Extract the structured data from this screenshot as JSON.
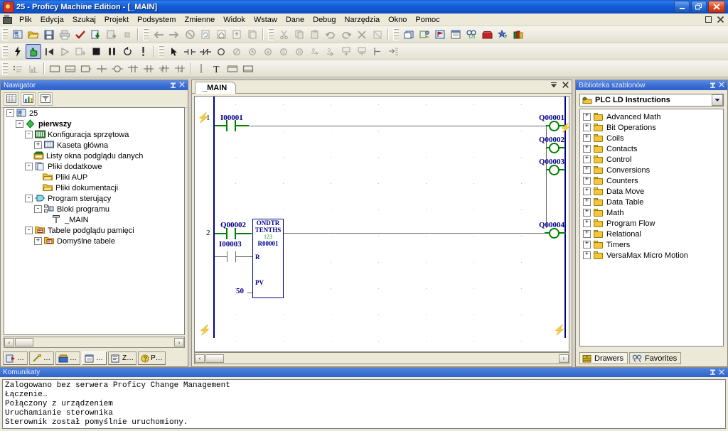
{
  "window": {
    "title": "25 - Proficy Machine Edition - [_MAIN]",
    "app_icon": "proficy-icon",
    "minimize": "–",
    "restore": "❐",
    "close": "✕"
  },
  "menubar": {
    "system_icon": "mdi-system-icon",
    "items": [
      {
        "label": "Plik",
        "accel": "P"
      },
      {
        "label": "Edycja",
        "accel": "E"
      },
      {
        "label": "Szukaj",
        "accel": "S"
      },
      {
        "label": "Projekt",
        "accel": "P"
      },
      {
        "label": "Podsystem",
        "accel": "o"
      },
      {
        "label": "Zmienne",
        "accel": "Z"
      },
      {
        "label": "Widok",
        "accel": "W"
      },
      {
        "label": "Wstaw",
        "accel": "W"
      },
      {
        "label": "Dane",
        "accel": "D"
      },
      {
        "label": "Debug",
        "accel": "D"
      },
      {
        "label": "Narzędzia",
        "accel": "N"
      },
      {
        "label": "Okno",
        "accel": "O"
      },
      {
        "label": "Pomoc",
        "accel": "P"
      }
    ],
    "mdi_restore": "❐",
    "mdi_close": "✕"
  },
  "toolbars": {
    "row1": [
      "new-project-icon",
      "open-folder-icon",
      "save-icon",
      "print-icon",
      "validate-check-icon",
      "download-icon",
      "upload-icon",
      "report-icon",
      "sep",
      "back-arrow-icon",
      "forward-arrow-icon",
      "stop-icon",
      "page-refresh-icon",
      "home-icon",
      "page-up-icon",
      "page-copy-icon",
      "sep",
      "cut-icon",
      "copy-icon",
      "paste-icon",
      "undo-icon",
      "redo-icon",
      "delete-x-icon",
      "clear-grid-icon",
      "sep",
      "new-window-icon",
      "variables-icon",
      "flag-icon",
      "properties-icon",
      "reference-view-icon",
      "toolchest-icon",
      "favorites-star-icon",
      "help-books-icon"
    ],
    "row2": [
      "lightning-online-icon",
      "hand-programmer-icon",
      "rewind-icon",
      "play-icon",
      "step-icon",
      "stop-square-icon",
      "pause-icon",
      "cycle-icon",
      "fault-icon",
      "sep",
      "pointer-icon",
      "contact-no-icon",
      "contact-nc-icon",
      "coil-icon",
      "coil-negated-icon",
      "coil-positive-transition-icon",
      "coil-negative-transition-icon",
      "coil-set-icon",
      "coil-reset-icon",
      "horizontal-wire-icon",
      "vertical-wire-icon",
      "comment-box-icon",
      "instruction-box-icon",
      "left-rail-icon",
      "goto-icon"
    ],
    "row3": [
      "bullet-list-icon",
      "chart-icon",
      "sep",
      "rect-icon",
      "rect-split-icon",
      "rect-open-icon",
      "cross-icon",
      "ellipse-icon",
      "tee-down-icon",
      "tee-cross-icon",
      "tee-half-icon",
      "tee-dash-icon",
      "sep",
      "vertical-bar-icon",
      "text-tool-icon",
      "label-box-icon",
      "frame-box-icon"
    ],
    "active_button": "hand-programmer-icon"
  },
  "navigator": {
    "title": "Nawigator",
    "pin_icon": "pin-icon",
    "close_icon": "close-icon",
    "toolbar": [
      "table-view-icon",
      "chart-view-icon",
      "filter-view-icon"
    ],
    "tree": [
      {
        "depth": 0,
        "expander": "-",
        "icon": "project-icon",
        "label": "25",
        "bold": false
      },
      {
        "depth": 1,
        "expander": "-",
        "icon": "target-green-diamond-icon",
        "label": "pierwszy",
        "bold": true
      },
      {
        "depth": 2,
        "expander": "-",
        "icon": "hardware-rack-icon",
        "label": "Konfiguracja sprzętowa",
        "bold": false
      },
      {
        "depth": 3,
        "expander": "+",
        "icon": "rack-icon",
        "label": "Kaseta główna",
        "bold": false
      },
      {
        "depth": 2,
        "expander": "",
        "icon": "data-watch-icon",
        "label": "Listy okna podglądu danych",
        "bold": false
      },
      {
        "depth": 2,
        "expander": "-",
        "icon": "supplemental-files-icon",
        "label": "Pliki dodatkowe",
        "bold": false
      },
      {
        "depth": 3,
        "expander": "",
        "icon": "folder-icon",
        "label": "Pliki AUP",
        "bold": false
      },
      {
        "depth": 3,
        "expander": "",
        "icon": "folder-icon",
        "label": "Pliki dokumentacji",
        "bold": false
      },
      {
        "depth": 2,
        "expander": "-",
        "icon": "logic-icon",
        "label": "Program sterujący",
        "bold": false
      },
      {
        "depth": 3,
        "expander": "-",
        "icon": "program-blocks-icon",
        "label": "Bloki programu",
        "bold": false
      },
      {
        "depth": 4,
        "expander": "",
        "icon": "ld-block-icon",
        "label": "_MAIN",
        "bold": false
      },
      {
        "depth": 2,
        "expander": "-",
        "icon": "ref-tables-folder-icon",
        "label": "Tabele podglądu pamięci",
        "bold": false
      },
      {
        "depth": 3,
        "expander": "+",
        "icon": "ref-table-icon",
        "label": "Domyślne tabele",
        "bold": false
      }
    ],
    "hscroll": {
      "left_arrow": "‹",
      "right_arrow": "›"
    },
    "tabs": [
      {
        "icon": "navigator-tab-icon",
        "label": "…",
        "selected": false
      },
      {
        "icon": "inspector-tab-icon",
        "label": "…",
        "selected": false
      },
      {
        "icon": "data-watch-tab-icon",
        "label": "…",
        "selected": false
      },
      {
        "icon": "infoview-tab-icon",
        "label": "…",
        "selected": true
      },
      {
        "icon": "companion-tab-icon",
        "label": "Z…",
        "selected": false
      },
      {
        "icon": "help-tab-icon",
        "label": "P…",
        "selected": false
      }
    ]
  },
  "ladder": {
    "tab_label": "_MAIN",
    "tab_menu_icon": "chevron-down-icon",
    "tab_close_icon": "close-icon",
    "online_bolt_icon": "lightning-bolt-icon",
    "hscroll": {
      "left_arrow": "‹",
      "right_arrow": "›"
    },
    "rungs": [
      {
        "number": "1",
        "contacts": [
          {
            "label": "I00001",
            "type": "normally-open"
          }
        ],
        "coils": [
          {
            "label": "Q00001",
            "type": "coil"
          },
          {
            "label": "Q00002",
            "type": "coil"
          },
          {
            "label": "Q00003",
            "type": "coil"
          }
        ]
      },
      {
        "number": "2",
        "contacts": [
          {
            "label": "Q00002",
            "type": "normally-open"
          },
          {
            "label": "I00003",
            "type": "normally-open"
          }
        ],
        "block": {
          "name": "ONDTR",
          "units": "TENTHS",
          "value": "123",
          "address": "R00001",
          "reset_pin": "R",
          "pv_pin": "PV",
          "pv_value": "50"
        },
        "coils": [
          {
            "label": "Q00004",
            "type": "coil"
          }
        ]
      }
    ]
  },
  "template_library": {
    "title": "Biblioteka szablonów",
    "pin_icon": "pin-icon",
    "close_icon": "close-icon",
    "combo": {
      "icon": "drawer-icon",
      "value": "PLC LD Instructions",
      "arrow": "▼"
    },
    "folders": [
      "Advanced Math",
      "Bit Operations",
      "Coils",
      "Contacts",
      "Control",
      "Conversions",
      "Counters",
      "Data Move",
      "Data Table",
      "Math",
      "Program Flow",
      "Relational",
      "Timers",
      "VersaMax Micro Motion"
    ],
    "tabs": [
      {
        "icon": "drawers-icon",
        "label": "Drawers",
        "selected": true
      },
      {
        "icon": "favorites-icon",
        "label": "Favorites",
        "selected": false
      }
    ]
  },
  "messages": {
    "title": "Komunikaty",
    "pin_icon": "pin-icon",
    "close_icon": "close-icon",
    "lines": [
      "Zalogowano bez serwera Proficy Change Management",
      "Łączenie…",
      "Połączony z urządzeniem",
      "Uruchamianie sterownika",
      "Sterownik został pomyślnie uruchomiony."
    ]
  },
  "colors": {
    "titlebar_blue": "#1560d8",
    "panel_caption": "#3b6fd4",
    "ladder_green": "#008000",
    "rail_blue": "#00008b",
    "label_navy": "#00008b",
    "chrome": "#ece9d8"
  }
}
